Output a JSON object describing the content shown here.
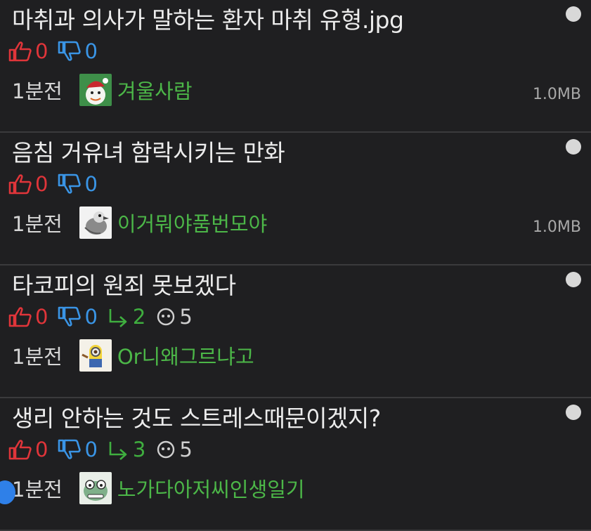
{
  "posts": [
    {
      "title": "마취과 의사가 말하는 환자 마취 유형.jpg",
      "likes": "0",
      "dislikes": "0",
      "replies": "",
      "views": "",
      "time": "1분전",
      "author": "겨울사람",
      "size": "1.0MB",
      "avatar": "snowman-avatar"
    },
    {
      "title": "음침 거유녀 함락시키는 만화",
      "likes": "0",
      "dislikes": "0",
      "replies": "",
      "views": "",
      "time": "1분전",
      "author": "이거뭐야품번모야",
      "size": "1.0MB",
      "avatar": "bird-avatar"
    },
    {
      "title": "타코피의 원죄 못보겠다",
      "likes": "0",
      "dislikes": "0",
      "replies": "2",
      "views": "5",
      "time": "1분전",
      "author": "Or니왜그르냐고",
      "size": "",
      "avatar": "minion-avatar"
    },
    {
      "title": "생리 안하는 것도 스트레스때문이겠지?",
      "likes": "0",
      "dislikes": "0",
      "replies": "3",
      "views": "5",
      "time": "1분전",
      "author": "노가다아저씨인생일기",
      "size": "",
      "avatar": "frog-avatar"
    }
  ],
  "colors": {
    "background": "#1f1f21",
    "like": "#e0353a",
    "dislike": "#3a95e6",
    "reply": "#3fae3f",
    "author": "#4cb748"
  }
}
